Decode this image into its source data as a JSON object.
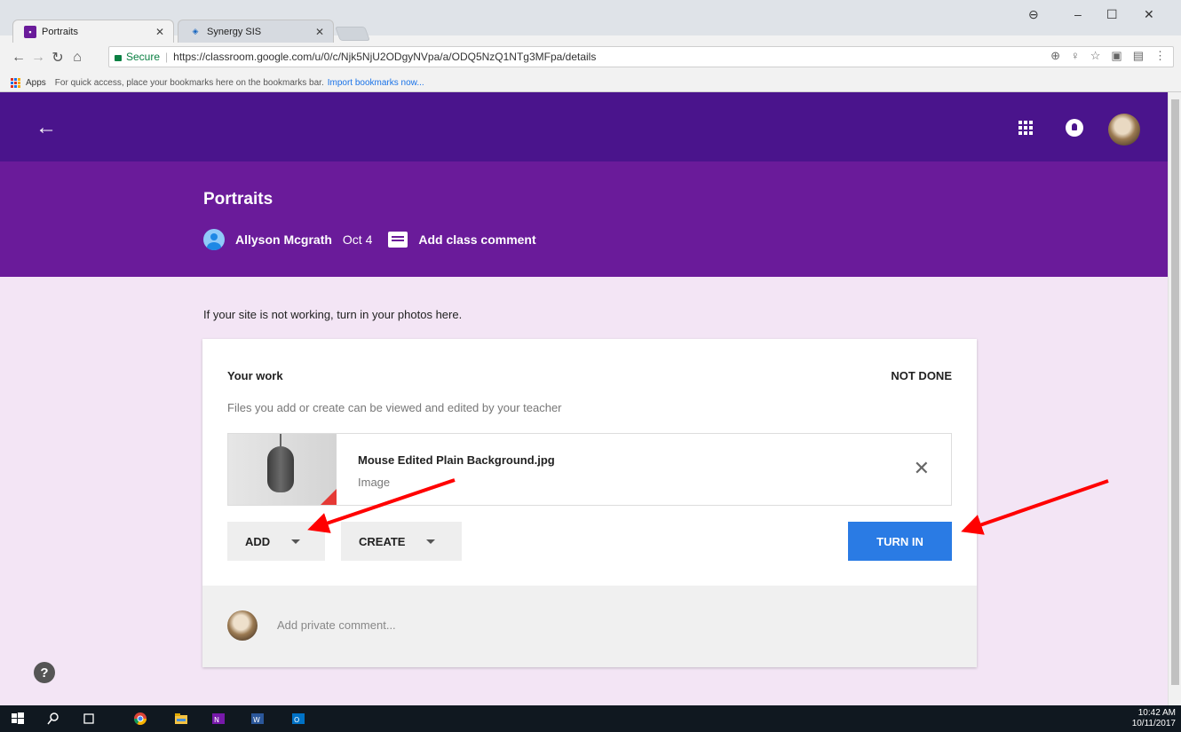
{
  "browser": {
    "tabs": [
      {
        "title": "Portraits",
        "favicon": "classroom-icon",
        "color": "#6a1b9a"
      },
      {
        "title": "Synergy SIS",
        "favicon": "synergy-icon",
        "color": "#1565c0"
      }
    ],
    "secure_label": "Secure",
    "url": "https://classroom.google.com/u/0/c/Njk5NjU2ODgyNVpa/a/ODQ5NzQ1NTg3MFpa/details",
    "bookmarks": {
      "apps_label": "Apps",
      "hint": "For quick access, place your bookmarks here on the bookmarks bar.",
      "import_link": "Import bookmarks now..."
    }
  },
  "assignment": {
    "title": "Portraits",
    "author": "Allyson Mcgrath",
    "date": "Oct 4",
    "add_class_comment": "Add class comment",
    "instructions": "If your site is not working, turn in your photos here."
  },
  "work": {
    "title": "Your work",
    "status": "NOT DONE",
    "subtitle": "Files you add or create can be viewed and edited by your teacher",
    "attachment": {
      "name": "Mouse Edited Plain Background.jpg",
      "type": "Image"
    },
    "add_label": "ADD",
    "create_label": "CREATE",
    "turn_in_label": "TURN IN",
    "private_comment_placeholder": "Add private comment..."
  },
  "taskbar": {
    "time": "10:42 AM",
    "date": "10/11/2017"
  },
  "colors": {
    "topbar": "#4a148c",
    "header": "#6a1b9a",
    "content_bg": "#f3e5f5",
    "turn_in": "#2a7be4",
    "annotation_arrow": "#ff0000"
  }
}
